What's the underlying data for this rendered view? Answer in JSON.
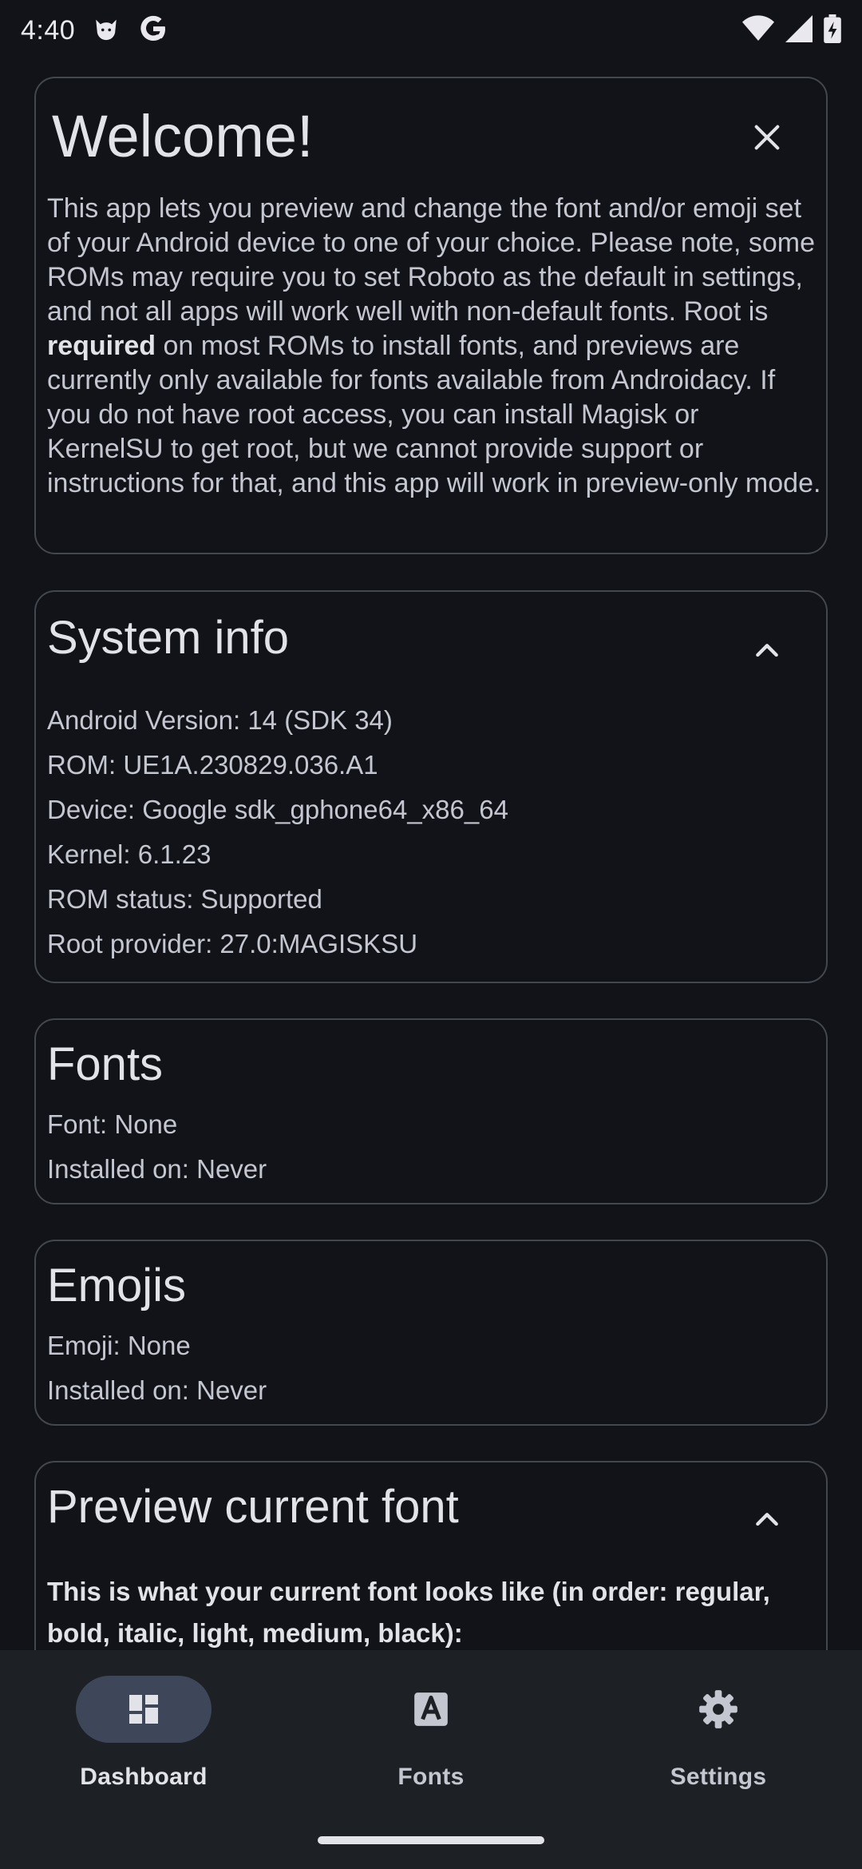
{
  "status_bar": {
    "time": "4:40",
    "left_icons": [
      "cat-face-icon",
      "google-g-icon"
    ],
    "right_icons": [
      "wifi-icon",
      "signal-icon",
      "battery-charging-icon"
    ]
  },
  "welcome_card": {
    "title": "Welcome!",
    "text_before_bold": "This app lets you preview and change the font and/or emoji set of your Android device to one of your choice. Please note, some ROMs may require you to set Roboto as the default in settings, and not all apps will work well with non-default fonts. Root is ",
    "text_bold": "required",
    "text_after_bold": " on most ROMs to install fonts, and previews are currently only available for fonts available from Androidacy. If you do not have root access, you can install Magisk or KernelSU to get root, but we cannot provide support or instructions for that, and this app will work in preview-only mode.",
    "close_icon": "close-icon"
  },
  "system_info": {
    "title": "System info",
    "lines": [
      "Android Version: 14 (SDK 34)",
      "ROM: UE1A.230829.036.A1",
      "Device: Google sdk_gphone64_x86_64",
      "Kernel: 6.1.23",
      "ROM status: Supported",
      "Root provider: 27.0:MAGISKSU"
    ]
  },
  "fonts_card": {
    "title": "Fonts",
    "font_line": "Font: None",
    "installed_line": "Installed on: Never"
  },
  "emojis_card": {
    "title": "Emojis",
    "emoji_line": "Emoji: None",
    "installed_line": "Installed on: Never"
  },
  "preview_card": {
    "title": "Preview current font",
    "description": "This is what your current font looks like (in order: regular, bold, italic, light, medium, black):"
  },
  "bottom_nav": {
    "items": [
      {
        "label": "Dashboard",
        "icon": "dashboard-icon",
        "active": true
      },
      {
        "label": "Fonts",
        "icon": "font-a-icon",
        "active": false
      },
      {
        "label": "Settings",
        "icon": "gear-icon",
        "active": false
      }
    ]
  },
  "colors": {
    "background": "#111318",
    "card_border": "#43474e",
    "nav_background": "#1d2024",
    "nav_active_pill": "#3e4759",
    "text_primary": "#e2e2e9",
    "text_secondary": "#c4c6d0"
  }
}
